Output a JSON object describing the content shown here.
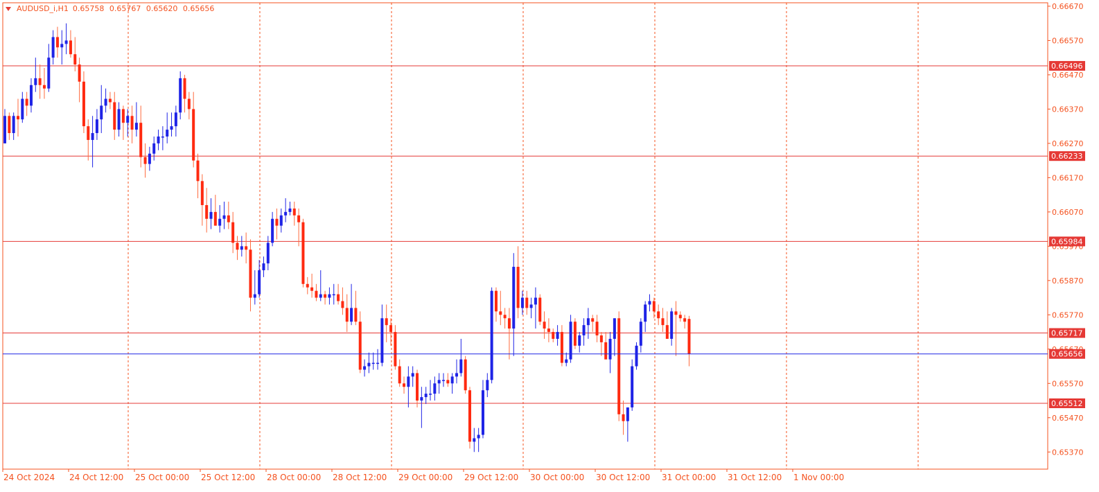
{
  "header": {
    "symbol": "AUDUSD_i,H1",
    "open": "0.65758",
    "high": "0.65767",
    "low": "0.65620",
    "close": "0.65656"
  },
  "colors": {
    "bull": "#1e23e6",
    "bear": "#ff2a10",
    "wick": "#ff6a3d",
    "grid": "#f4511e",
    "axis_text": "#f4511e",
    "hline": "#e53935",
    "price_line": "#1e23e6",
    "label_bg": "#e53935",
    "label_text": "#ffffff"
  },
  "chart_data": {
    "type": "candlestick",
    "timeframe": "H1",
    "grid": true,
    "ylim": [
      0.6532,
      0.6668
    ],
    "y_ticks": [
      "0.66670",
      "0.66570",
      "0.66470",
      "0.66370",
      "0.66270",
      "0.66170",
      "0.66070",
      "0.65970",
      "0.65870",
      "0.65770",
      "0.65670",
      "0.65570",
      "0.65470",
      "0.65370"
    ],
    "x_labels": [
      "24 Oct 2024",
      "24 Oct 12:00",
      "25 Oct 00:00",
      "25 Oct 12:00",
      "28 Oct 00:00",
      "28 Oct 12:00",
      "29 Oct 00:00",
      "29 Oct 12:00",
      "30 Oct 00:00",
      "30 Oct 12:00",
      "31 Oct 00:00",
      "31 Oct 12:00",
      "1 Nov 00:00"
    ],
    "horizontal_levels": [
      {
        "value": 0.66496,
        "label": "0.66496"
      },
      {
        "value": 0.66233,
        "label": "0.66233"
      },
      {
        "value": 0.65984,
        "label": "0.65984"
      },
      {
        "value": 0.65717,
        "label": "0.65717"
      },
      {
        "value": 0.65512,
        "label": "0.65512"
      }
    ],
    "current_price": {
      "value": 0.65656,
      "label": "0.65656"
    },
    "candles": [
      [
        0.6627,
        0.6637,
        0.6627,
        0.6635
      ],
      [
        0.6635,
        0.6636,
        0.6628,
        0.663
      ],
      [
        0.663,
        0.6636,
        0.6628,
        0.6635
      ],
      [
        0.6635,
        0.664,
        0.6629,
        0.6634
      ],
      [
        0.6634,
        0.6642,
        0.6633,
        0.664
      ],
      [
        0.664,
        0.6642,
        0.6635,
        0.6638
      ],
      [
        0.6638,
        0.6646,
        0.6636,
        0.6644
      ],
      [
        0.6644,
        0.6652,
        0.6642,
        0.6646
      ],
      [
        0.6646,
        0.665,
        0.664,
        0.6644
      ],
      [
        0.6644,
        0.6649,
        0.664,
        0.6643
      ],
      [
        0.6643,
        0.6656,
        0.6642,
        0.6652
      ],
      [
        0.6652,
        0.666,
        0.665,
        0.6658
      ],
      [
        0.6658,
        0.6661,
        0.6652,
        0.6655
      ],
      [
        0.6655,
        0.666,
        0.665,
        0.6656
      ],
      [
        0.6656,
        0.6662,
        0.6653,
        0.6657
      ],
      [
        0.6657,
        0.666,
        0.6652,
        0.6653
      ],
      [
        0.6653,
        0.6658,
        0.6648,
        0.665
      ],
      [
        0.665,
        0.6652,
        0.6639,
        0.6645
      ],
      [
        0.6645,
        0.6648,
        0.663,
        0.6632
      ],
      [
        0.6632,
        0.6634,
        0.6622,
        0.6628
      ],
      [
        0.6628,
        0.6635,
        0.662,
        0.663
      ],
      [
        0.663,
        0.6637,
        0.6628,
        0.6634
      ],
      [
        0.6634,
        0.6644,
        0.663,
        0.6638
      ],
      [
        0.6638,
        0.6643,
        0.6636,
        0.664
      ],
      [
        0.664,
        0.6642,
        0.6637,
        0.6639
      ],
      [
        0.6639,
        0.6642,
        0.6628,
        0.6631
      ],
      [
        0.6631,
        0.6639,
        0.6629,
        0.6637
      ],
      [
        0.6637,
        0.6638,
        0.6628,
        0.6633
      ],
      [
        0.6633,
        0.6637,
        0.6629,
        0.6635
      ],
      [
        0.6635,
        0.6638,
        0.6627,
        0.6631
      ],
      [
        0.6631,
        0.6639,
        0.6629,
        0.6633
      ],
      [
        0.6633,
        0.6638,
        0.662,
        0.6623
      ],
      [
        0.6623,
        0.6627,
        0.6617,
        0.6621
      ],
      [
        0.6621,
        0.6626,
        0.6619,
        0.6624
      ],
      [
        0.6624,
        0.6629,
        0.6622,
        0.6627
      ],
      [
        0.6627,
        0.6631,
        0.6625,
        0.6629
      ],
      [
        0.6629,
        0.6632,
        0.6625,
        0.6629
      ],
      [
        0.6629,
        0.6636,
        0.6627,
        0.6631
      ],
      [
        0.6631,
        0.6636,
        0.6629,
        0.6632
      ],
      [
        0.6632,
        0.6638,
        0.6629,
        0.6636
      ],
      [
        0.6636,
        0.6648,
        0.6634,
        0.6646
      ],
      [
        0.6646,
        0.6647,
        0.6636,
        0.664
      ],
      [
        0.664,
        0.6642,
        0.6634,
        0.6637
      ],
      [
        0.6637,
        0.6642,
        0.662,
        0.6622
      ],
      [
        0.6622,
        0.6624,
        0.6611,
        0.6616
      ],
      [
        0.6616,
        0.6618,
        0.6603,
        0.6609
      ],
      [
        0.6609,
        0.6614,
        0.6601,
        0.6605
      ],
      [
        0.6605,
        0.6611,
        0.6602,
        0.6607
      ],
      [
        0.6607,
        0.6612,
        0.6603,
        0.6603
      ],
      [
        0.6603,
        0.6609,
        0.6601,
        0.6605
      ],
      [
        0.6605,
        0.661,
        0.6602,
        0.6606
      ],
      [
        0.6606,
        0.661,
        0.6602,
        0.6604
      ],
      [
        0.6604,
        0.6607,
        0.6595,
        0.6598
      ],
      [
        0.6598,
        0.66,
        0.6593,
        0.6596
      ],
      [
        0.6596,
        0.66,
        0.6594,
        0.6597
      ],
      [
        0.6597,
        0.6601,
        0.6592,
        0.6596
      ],
      [
        0.6596,
        0.6599,
        0.6578,
        0.6582
      ],
      [
        0.6582,
        0.659,
        0.658,
        0.6583
      ],
      [
        0.6583,
        0.6593,
        0.6582,
        0.659
      ],
      [
        0.659,
        0.6594,
        0.6588,
        0.6592
      ],
      [
        0.6592,
        0.66,
        0.659,
        0.6598
      ],
      [
        0.6598,
        0.6607,
        0.6597,
        0.6605
      ],
      [
        0.6605,
        0.6608,
        0.6599,
        0.6603
      ],
      [
        0.6603,
        0.6608,
        0.6601,
        0.6606
      ],
      [
        0.6606,
        0.6611,
        0.6604,
        0.6607
      ],
      [
        0.6607,
        0.661,
        0.6606,
        0.6608
      ],
      [
        0.6608,
        0.661,
        0.6603,
        0.6606
      ],
      [
        0.6606,
        0.6608,
        0.6597,
        0.6604
      ],
      [
        0.6604,
        0.6605,
        0.6585,
        0.6586
      ],
      [
        0.6586,
        0.6588,
        0.6583,
        0.6585
      ],
      [
        0.6585,
        0.6589,
        0.6582,
        0.6584
      ],
      [
        0.6584,
        0.6586,
        0.6581,
        0.6582
      ],
      [
        0.6582,
        0.659,
        0.6581,
        0.6583
      ],
      [
        0.6583,
        0.6584,
        0.658,
        0.6582
      ],
      [
        0.6582,
        0.6585,
        0.658,
        0.6583
      ],
      [
        0.6583,
        0.6586,
        0.658,
        0.6583
      ],
      [
        0.6583,
        0.6586,
        0.658,
        0.6581
      ],
      [
        0.6581,
        0.6585,
        0.6577,
        0.6579
      ],
      [
        0.6579,
        0.6583,
        0.6572,
        0.6575
      ],
      [
        0.6575,
        0.6586,
        0.6574,
        0.6579
      ],
      [
        0.6579,
        0.6584,
        0.6574,
        0.6575
      ],
      [
        0.6575,
        0.6578,
        0.656,
        0.6561
      ],
      [
        0.6561,
        0.6564,
        0.6559,
        0.6562
      ],
      [
        0.6562,
        0.6566,
        0.656,
        0.6563
      ],
      [
        0.6563,
        0.6566,
        0.6561,
        0.6563
      ],
      [
        0.6563,
        0.6567,
        0.6561,
        0.6563
      ],
      [
        0.6563,
        0.658,
        0.6562,
        0.6576
      ],
      [
        0.6576,
        0.658,
        0.6569,
        0.6574
      ],
      [
        0.6574,
        0.6576,
        0.6568,
        0.6572
      ],
      [
        0.6572,
        0.6574,
        0.6561,
        0.6562
      ],
      [
        0.6562,
        0.6564,
        0.6556,
        0.6557
      ],
      [
        0.6557,
        0.6559,
        0.6554,
        0.6556
      ],
      [
        0.6556,
        0.6562,
        0.655,
        0.6559
      ],
      [
        0.6559,
        0.6562,
        0.6556,
        0.656
      ],
      [
        0.656,
        0.6561,
        0.655,
        0.6552
      ],
      [
        0.6552,
        0.6556,
        0.6544,
        0.6553
      ],
      [
        0.6553,
        0.6556,
        0.6551,
        0.6554
      ],
      [
        0.6554,
        0.6558,
        0.6552,
        0.6554
      ],
      [
        0.6554,
        0.6559,
        0.6552,
        0.6557
      ],
      [
        0.6557,
        0.656,
        0.6554,
        0.6558
      ],
      [
        0.6558,
        0.656,
        0.6556,
        0.6558
      ],
      [
        0.6558,
        0.656,
        0.6556,
        0.6557
      ],
      [
        0.6557,
        0.656,
        0.6554,
        0.6559
      ],
      [
        0.6559,
        0.6564,
        0.6557,
        0.656
      ],
      [
        0.656,
        0.657,
        0.6559,
        0.6564
      ],
      [
        0.6564,
        0.6565,
        0.6554,
        0.6555
      ],
      [
        0.6555,
        0.6556,
        0.6538,
        0.654
      ],
      [
        0.654,
        0.6544,
        0.6537,
        0.6541
      ],
      [
        0.6541,
        0.6544,
        0.6537,
        0.6542
      ],
      [
        0.6542,
        0.6558,
        0.6541,
        0.6555
      ],
      [
        0.6555,
        0.656,
        0.6553,
        0.6558
      ],
      [
        0.6558,
        0.6585,
        0.6557,
        0.6584
      ],
      [
        0.6584,
        0.6585,
        0.6575,
        0.6578
      ],
      [
        0.6578,
        0.6584,
        0.6574,
        0.6577
      ],
      [
        0.6577,
        0.6579,
        0.6573,
        0.6576
      ],
      [
        0.6576,
        0.6579,
        0.6564,
        0.6573
      ],
      [
        0.6573,
        0.6595,
        0.6565,
        0.6591
      ],
      [
        0.6591,
        0.6597,
        0.6576,
        0.6579
      ],
      [
        0.6579,
        0.6584,
        0.6577,
        0.6582
      ],
      [
        0.6582,
        0.6584,
        0.6577,
        0.6579
      ],
      [
        0.6579,
        0.6582,
        0.6576,
        0.658
      ],
      [
        0.658,
        0.6585,
        0.6573,
        0.6582
      ],
      [
        0.6582,
        0.6583,
        0.6574,
        0.6575
      ],
      [
        0.6575,
        0.6578,
        0.657,
        0.6573
      ],
      [
        0.6573,
        0.6576,
        0.6569,
        0.6572
      ],
      [
        0.6572,
        0.6573,
        0.6569,
        0.657
      ],
      [
        0.657,
        0.6574,
        0.6568,
        0.6572
      ],
      [
        0.6572,
        0.6574,
        0.6562,
        0.6563
      ],
      [
        0.6563,
        0.6566,
        0.6562,
        0.6564
      ],
      [
        0.6564,
        0.6577,
        0.6563,
        0.6575
      ],
      [
        0.6575,
        0.6576,
        0.6567,
        0.6568
      ],
      [
        0.6568,
        0.6572,
        0.6566,
        0.6571
      ],
      [
        0.6571,
        0.6576,
        0.6568,
        0.6574
      ],
      [
        0.6574,
        0.6579,
        0.657,
        0.6576
      ],
      [
        0.6576,
        0.6577,
        0.6572,
        0.6575
      ],
      [
        0.6575,
        0.6577,
        0.6569,
        0.6571
      ],
      [
        0.6571,
        0.6572,
        0.6565,
        0.6569
      ],
      [
        0.6569,
        0.6572,
        0.6564,
        0.6564
      ],
      [
        0.6564,
        0.6572,
        0.656,
        0.657
      ],
      [
        0.657,
        0.6576,
        0.6565,
        0.6576
      ],
      [
        0.6576,
        0.6578,
        0.6546,
        0.6548
      ],
      [
        0.6548,
        0.6552,
        0.6542,
        0.6546
      ],
      [
        0.6546,
        0.655,
        0.654,
        0.655
      ],
      [
        0.655,
        0.6564,
        0.6549,
        0.6562
      ],
      [
        0.6562,
        0.6569,
        0.6561,
        0.6568
      ],
      [
        0.6568,
        0.6576,
        0.6566,
        0.6575
      ],
      [
        0.6575,
        0.6581,
        0.6572,
        0.658
      ],
      [
        0.658,
        0.6583,
        0.6578,
        0.6581
      ],
      [
        0.6581,
        0.6582,
        0.6576,
        0.6578
      ],
      [
        0.6578,
        0.658,
        0.6574,
        0.6576
      ],
      [
        0.6576,
        0.6579,
        0.6572,
        0.6574
      ],
      [
        0.6574,
        0.6578,
        0.657,
        0.657
      ],
      [
        0.657,
        0.6579,
        0.6568,
        0.6578
      ],
      [
        0.6578,
        0.6581,
        0.6565,
        0.6577
      ],
      [
        0.6577,
        0.6578,
        0.6575,
        0.6576
      ],
      [
        0.6576,
        0.6577,
        0.6573,
        0.6575
      ],
      [
        0.65758,
        0.65767,
        0.6562,
        0.65656
      ]
    ]
  }
}
